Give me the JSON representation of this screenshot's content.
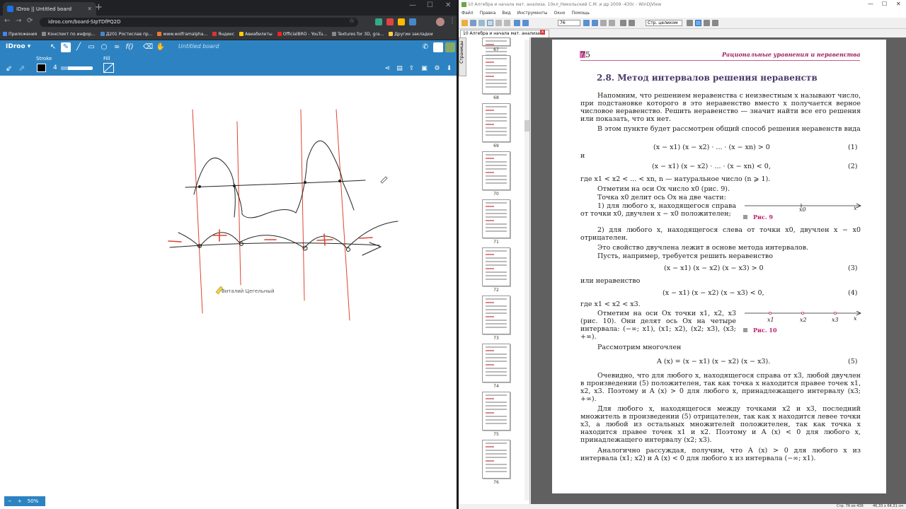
{
  "chrome": {
    "tab1": "IDroo || Untitled board",
    "new_tab": "+",
    "window_controls": [
      "—",
      "☐",
      "✕"
    ],
    "url": "idroo.com/board-SIpTDfPQ2D",
    "bookmarks": [
      "Приложения",
      "Конспект по инфор...",
      "Д201 Ростислав пр...",
      "www.wolframalpha...",
      "Яндекс",
      "Авиабилеты",
      "OfficialBRO - YouTu...",
      "Textures for 3D, gra...",
      "Другие закладки"
    ]
  },
  "idroo": {
    "logo": "IDroo",
    "board_title": "Untitled board",
    "tools": [
      "select",
      "pen",
      "line",
      "rect",
      "ellipse",
      "formula",
      "eraser",
      "hand"
    ],
    "stroke_label": "Stroke",
    "stroke_size": "4",
    "fill_label": "Fill",
    "zoom": "50%",
    "zoom_minus": "−",
    "zoom_plus": "+",
    "cursor_user": "Виталий Цегельный",
    "colors": {
      "bar": "#2d83c2",
      "ink": "#222222",
      "red": "#e0442e"
    }
  },
  "wdv": {
    "title": "10 Алгебра и начала мат. анализа. 10кл_Никольский С.М. и др 2009 -430с - WinDjView",
    "menu": [
      "Файл",
      "Правка",
      "Вид",
      "Инструменты",
      "Окно",
      "Помощь"
    ],
    "page_input": "76",
    "zoom_select": "Стр. целиком",
    "tab": "10 Алгебра и начала мат. анализа ...",
    "pages_tab": "Страницы",
    "thumbs": [
      "67",
      "68",
      "69",
      "70",
      "71",
      "72",
      "73",
      "74",
      "75",
      "76"
    ],
    "status": [
      "Стр. 76 из 436",
      "46,33 x 64,31 см"
    ]
  },
  "book": {
    "page_number": "75",
    "running_head": "Рациональные уравнения и неравенства",
    "section": "2.8. Метод интервалов решения неравенств",
    "p1": "Напомним, что решением неравенства с неизвестным x называют число, при подстановке которого в это неравенство вместо x получается верное числовое неравенство. Решить неравенство — значит найти все его решения или показать, что их нет.",
    "p2": "В этом пункте будет рассмотрен общий способ решения неравенств вида",
    "eq1": "(x − x1) (x − x2) · ... · (x − xn) > 0",
    "eq1n": "(1)",
    "and": "и",
    "eq2": "(x − x1) (x − x2) · ... · (x − xn) < 0,",
    "eq2n": "(2)",
    "p3": "где x1 < x2 < ... < xn, n — натуральное число (n ⩾ 1).",
    "p4": "Отметим на оси Ox число x0 (рис. 9).",
    "p5": "Точка x0 делит ось Ox на две части:",
    "p6": "1) для любого x, находящегося справа от точки x0, двучлен x − x0 положителен;",
    "fig9": "Рис. 9",
    "fig9_labels": [
      "x0",
      "x"
    ],
    "p7": "2) для любого x, находящегося слева от точки x0, двучлен x − x0 отрицателен.",
    "p8": "Это свойство двучлена лежит в основе метода интервалов.",
    "p9": "Пусть, например, требуется решить неравенство",
    "eq3": "(x − x1) (x − x2) (x − x3) > 0",
    "eq3n": "(3)",
    "p10": "или неравенство",
    "eq4": "(x − x1) (x − x2) (x − x3) < 0,",
    "eq4n": "(4)",
    "p11": "где x1 < x2 < x3.",
    "p12": "Отметим на оси Ox точки x1, x2, x3 (рис. 10). Они делят ось Ox на четыре интервала: (−∞; x1), (x1; x2), (x2; x3), (x3; +∞).",
    "fig10": "Рис. 10",
    "fig10_labels": [
      "x1",
      "x2",
      "x3",
      "x"
    ],
    "p13": "Рассмотрим многочлен",
    "eq5": "A (x) = (x − x1) (x − x2) (x − x3).",
    "eq5n": "(5)",
    "p14": "Очевидно, что для любого x, находящегося справа от x3, любой двучлен в произведении (5) положителен, так как точка x находится правее точек x1, x2, x3. Поэтому и A (x) > 0 для любого x, принадлежащего интервалу (x3; +∞).",
    "p15": "Для любого x, находящегося между точками x2 и x3, последний множитель в произведении (5) отрицателен, так как x находится левее точки x3, а любой из остальных множителей положителен, так как точка x находится правее точек x1 и x2. Поэтому и A (x) < 0 для любого x, принадлежащего интервалу (x2; x3).",
    "p16": "Аналогично рассуждая, получим, что A (x) > 0 для любого x из интервала (x1; x2) и A (x) < 0 для любого x из интервала (−∞; x1)."
  }
}
